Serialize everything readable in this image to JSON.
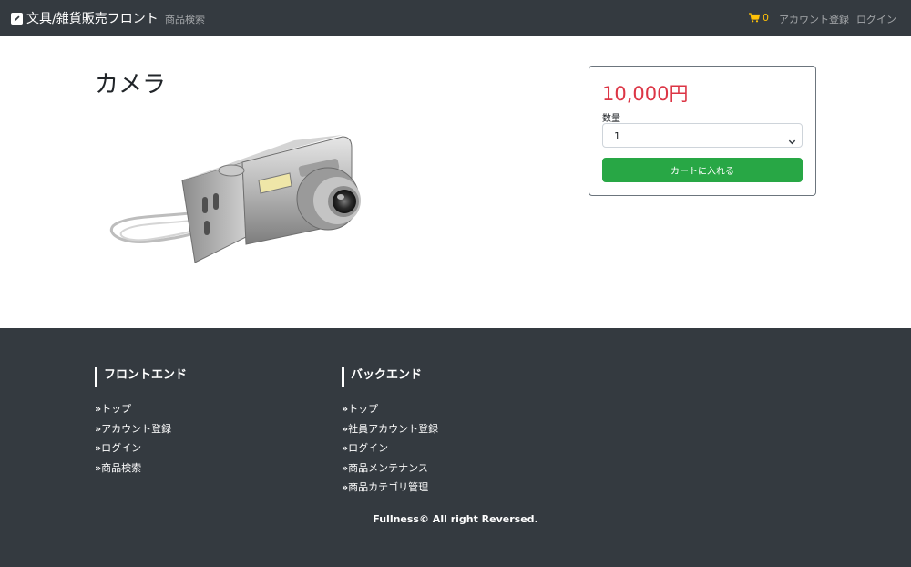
{
  "navbar": {
    "brand": "文具/雑貨販売フロント",
    "brand_icon": "pencil-square-icon",
    "search_link": "商品検索",
    "cart_icon": "shopping-cart-icon",
    "cart_count": "0",
    "register_link": "アカウント登録",
    "login_link": "ログイン"
  },
  "product": {
    "title": "カメラ",
    "image": "camera-image",
    "price": "10,000円",
    "quantity_label": "数量",
    "quantity_value": "1",
    "add_to_cart_label": "カートに入れる"
  },
  "footer": {
    "columns": [
      {
        "heading": "フロントエンド",
        "links": [
          "トップ",
          "アカウント登録",
          "ログイン",
          "商品検索"
        ]
      },
      {
        "heading": "バックエンド",
        "links": [
          "トップ",
          "社員アカウント登録",
          "ログイン",
          "商品メンテナンス",
          "商品カテゴリ管理"
        ]
      }
    ],
    "link_prefix": "»",
    "copyright": "Fullness© All right Reversed."
  },
  "colors": {
    "navbar_bg": "#343a40",
    "price": "#dc3545",
    "button": "#28a745",
    "cart": "#ffc107"
  }
}
